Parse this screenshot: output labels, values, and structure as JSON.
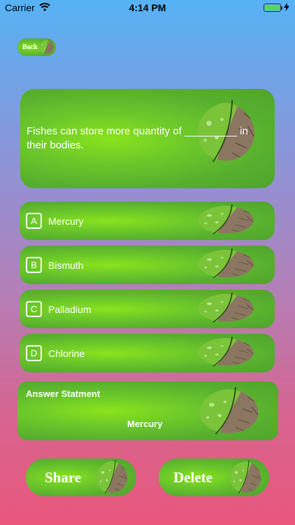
{
  "status_bar": {
    "carrier": "Carrier",
    "time": "4:14 PM",
    "icons": [
      "wifi-icon",
      "battery-icon",
      "charging-icon"
    ],
    "battery_color": "#4CD964"
  },
  "back_button": {
    "label": "Back"
  },
  "question": {
    "text": "Fishes can store more quantity of _________ in their bodies."
  },
  "options": [
    {
      "letter": "A",
      "label": "Mercury"
    },
    {
      "letter": "B",
      "label": "Bismuth"
    },
    {
      "letter": "C",
      "label": "Palladium"
    },
    {
      "letter": "D",
      "label": "Chlorine"
    }
  ],
  "answer": {
    "title": "Answer Statment",
    "value": "Mercury"
  },
  "actions": {
    "share_label": "Share",
    "delete_label": "Delete"
  },
  "colors": {
    "background_top": "#56B2F4",
    "background_bottom": "#E9577C",
    "card_green": "#6CC82A"
  }
}
